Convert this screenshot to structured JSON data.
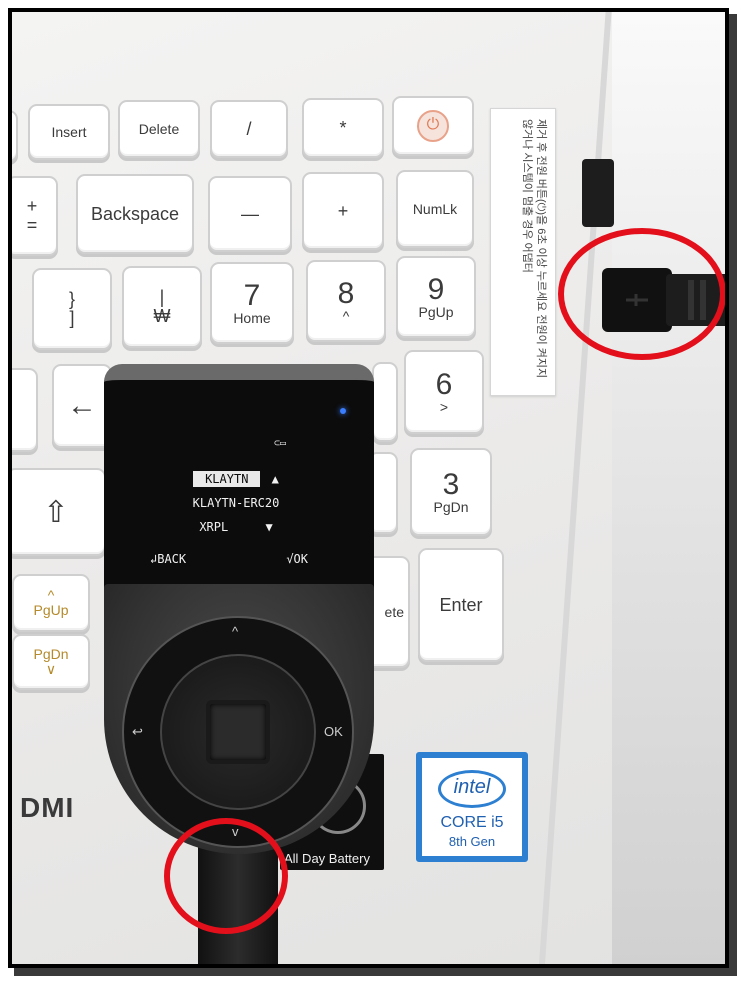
{
  "keyboard": {
    "insert": "Insert",
    "delete": "Delete",
    "slash": "/",
    "asterisk": "*",
    "power": "⏻",
    "plus_equal_top": "+",
    "plus_equal_bot": "=",
    "backspace": "Backspace",
    "minus": "—",
    "plus": "+",
    "numlk": "NumLk",
    "brace_top": "}",
    "brace_bot": "]",
    "pipe_top": "|",
    "pipe_bot": "₩",
    "seven": "7",
    "seven_sub": "Home",
    "eight": "8",
    "eight_sub": "^",
    "nine": "9",
    "nine_sub": "PgUp",
    "arrow_left": "←",
    "six": "6",
    "six_sub": ">",
    "shift": "⇧",
    "three": "3",
    "three_sub": "PgDn",
    "enter": "Enter",
    "pgup_sub": "^",
    "pgup": "PgUp",
    "pgdn": "PgDn",
    "pgdn_sub": "∨",
    "delete_partial": "ete"
  },
  "sticker": {
    "text": "제거 후 전원 버튼(⏻)을 6초 이상 누르세요 전원이 켜지지 않거나 시스템이 멈출 경우 어댑터"
  },
  "device": {
    "screen": {
      "line1": "KLAYTN",
      "line1_arrow": "▲",
      "line2": "KLAYTN-ERC20",
      "line3": "XRPL",
      "line3_arrow": "▼",
      "back": "↲BACK",
      "ok": "√OK",
      "battery": "⊂▭"
    },
    "nav": {
      "up": "^",
      "down": "v",
      "ok": "OK",
      "back": "↩"
    }
  },
  "labels": {
    "intel": "intel",
    "core": "CORE i5",
    "gen": "8th Gen",
    "battery": "All Day Battery",
    "hdmi": "DMI"
  },
  "colors": {
    "highlight": "#e3101c",
    "intel_blue": "#2d7fd1"
  }
}
